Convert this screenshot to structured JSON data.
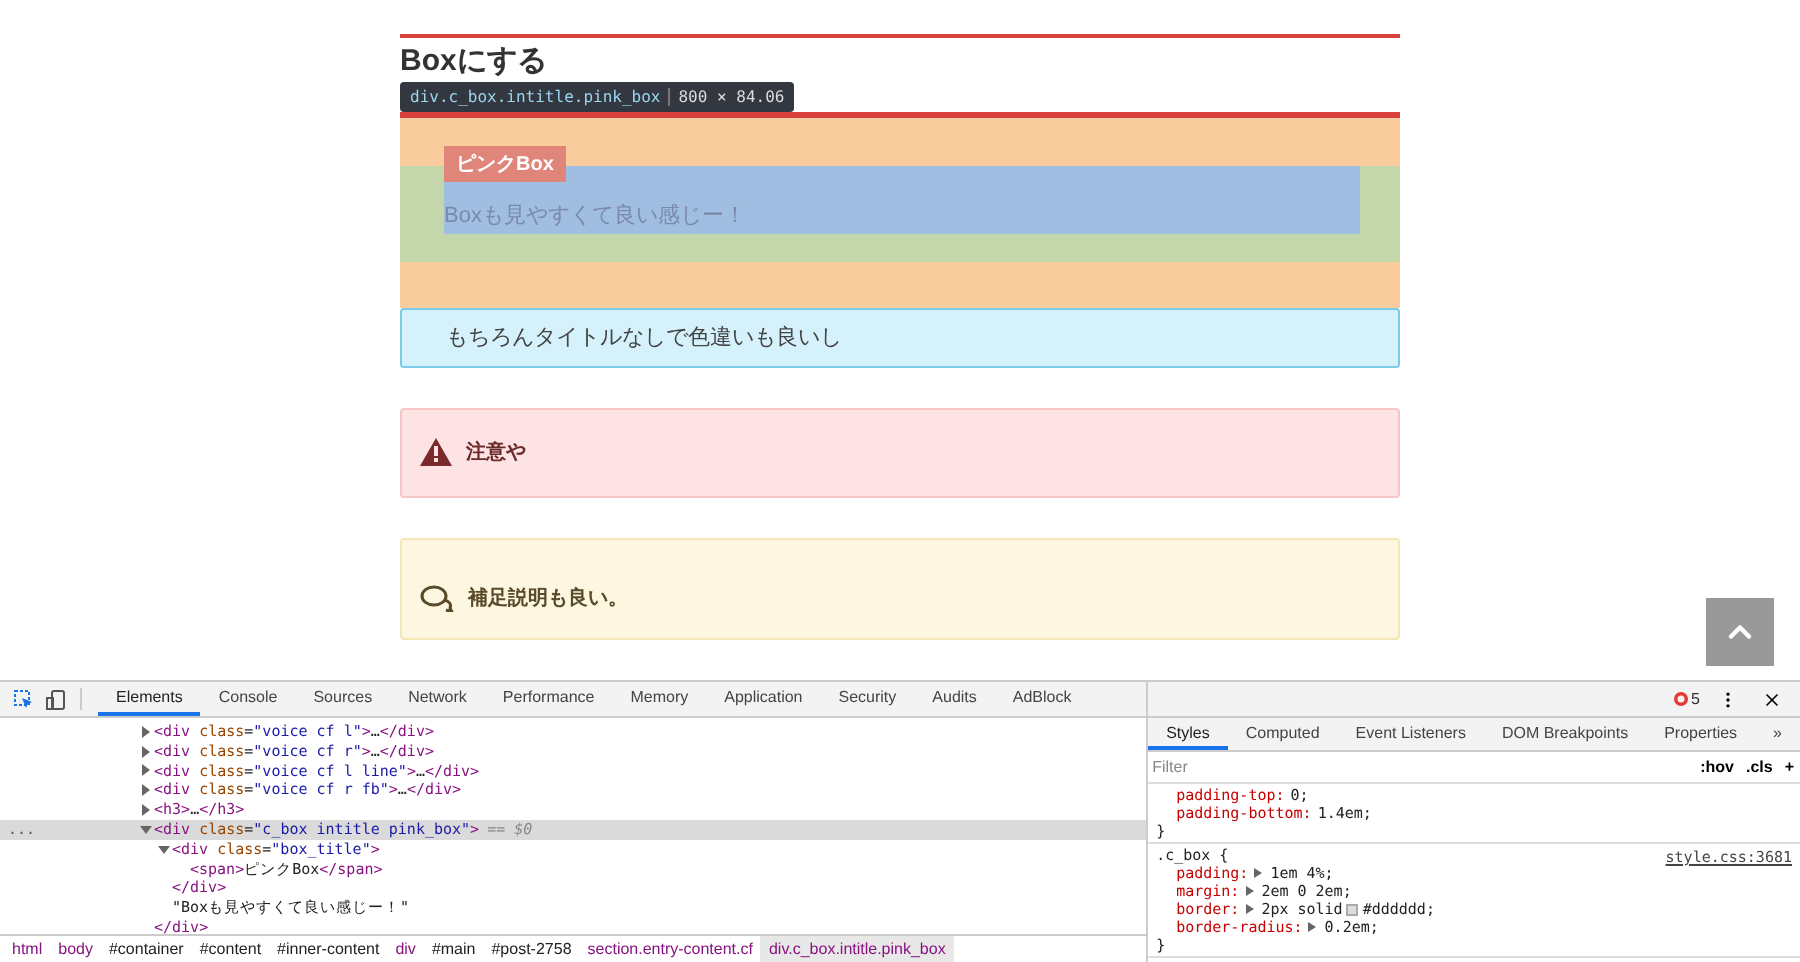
{
  "page": {
    "heading": "Boxにする",
    "inspect_tooltip": {
      "selector": "div.c_box.intitle.pink_box",
      "size": "800 × 84.06"
    },
    "pink_box": {
      "title": "ピンクBox",
      "text": "Boxも見やすくて良い感じー！"
    },
    "boxes": [
      {
        "kind": "info",
        "text": "もちろんタイトルなしで色違いも良いし"
      },
      {
        "kind": "alert",
        "text": "注意や"
      },
      {
        "kind": "note",
        "text": "補足説明も良い。"
      }
    ]
  },
  "devtools": {
    "tabs": [
      {
        "label": "Elements",
        "selected": true
      },
      {
        "label": "Console",
        "selected": false
      },
      {
        "label": "Sources",
        "selected": false
      },
      {
        "label": "Network",
        "selected": false
      },
      {
        "label": "Performance",
        "selected": false
      },
      {
        "label": "Memory",
        "selected": false
      },
      {
        "label": "Application",
        "selected": false
      },
      {
        "label": "Security",
        "selected": false
      },
      {
        "label": "Audits",
        "selected": false
      },
      {
        "label": "AdBlock",
        "selected": false
      }
    ],
    "error_count": "5",
    "dom_tree": [
      {
        "text": "<div class=\"voice cf l\">…</div>",
        "expanded": false,
        "selected": false
      },
      {
        "text": "<div class=\"voice cf r\">…</div>",
        "expanded": false,
        "selected": false
      },
      {
        "text": "<div class=\"voice cf l line\">…</div>",
        "expanded": false,
        "selected": false
      },
      {
        "text": "<div class=\"voice cf r fb\">…</div>",
        "expanded": false,
        "selected": false
      },
      {
        "text": "<h3>…</h3>",
        "expanded": false,
        "selected": false
      },
      {
        "text": "<div class=\"c_box intitle pink_box\">",
        "note": "== $0",
        "gutter": "...",
        "expanded": true,
        "selected": true,
        "closing": "</div>",
        "children": [
          {
            "text": "<div class=\"box_title\">",
            "expanded": true,
            "selected": false,
            "closing": "</div>",
            "children": [
              {
                "text": "<span>ピンクBox</span>",
                "selected": false
              }
            ]
          },
          {
            "text": "\"Boxも見やすくて良い感じー！\"",
            "selected": false
          }
        ]
      }
    ],
    "breadcrumbs": [
      {
        "label": "html",
        "kind": "tag",
        "selected": false
      },
      {
        "label": "body",
        "kind": "tag",
        "selected": false
      },
      {
        "label": "#container",
        "kind": "id",
        "selected": false
      },
      {
        "label": "#content",
        "kind": "id",
        "selected": false
      },
      {
        "label": "#inner-content",
        "kind": "id",
        "selected": false
      },
      {
        "label": "div",
        "kind": "tag",
        "selected": false
      },
      {
        "label": "#main",
        "kind": "id",
        "selected": false
      },
      {
        "label": "#post-2758",
        "kind": "id",
        "selected": false
      },
      {
        "label": "section.entry-content.cf",
        "kind": "tag",
        "selected": false
      },
      {
        "label": "div.c_box.intitle.pink_box",
        "kind": "tag",
        "selected": true
      }
    ],
    "styles_tabs": [
      {
        "label": "Styles",
        "selected": true
      },
      {
        "label": "Computed",
        "selected": false
      },
      {
        "label": "Event Listeners",
        "selected": false
      },
      {
        "label": "DOM Breakpoints",
        "selected": false
      },
      {
        "label": "Properties",
        "selected": false
      }
    ],
    "styles_overflow": "»",
    "filter": {
      "placeholder": "Filter"
    },
    "filter_buttons": [
      ":hov",
      ".cls",
      "+"
    ],
    "rules": [
      {
        "props": [
          {
            "name": "padding-top:",
            "value": "0;",
            "expandable": false
          },
          {
            "name": "padding-bottom:",
            "value": "1.4em;",
            "expandable": false
          }
        ],
        "close": "}"
      },
      {
        "selector": ".c_box {",
        "source": "style.css:3681",
        "props": [
          {
            "name": "padding:",
            "value": "1em 4%;",
            "expandable": true
          },
          {
            "name": "margin:",
            "value": "2em 0 2em;",
            "expandable": true
          },
          {
            "name": "border:",
            "value": "2px solid",
            "swatch": "#dddddd",
            "value_end": ";",
            "expandable": true
          },
          {
            "name": "border-radius:",
            "value": "0.2em;",
            "expandable": true
          }
        ],
        "close": "}"
      }
    ]
  }
}
